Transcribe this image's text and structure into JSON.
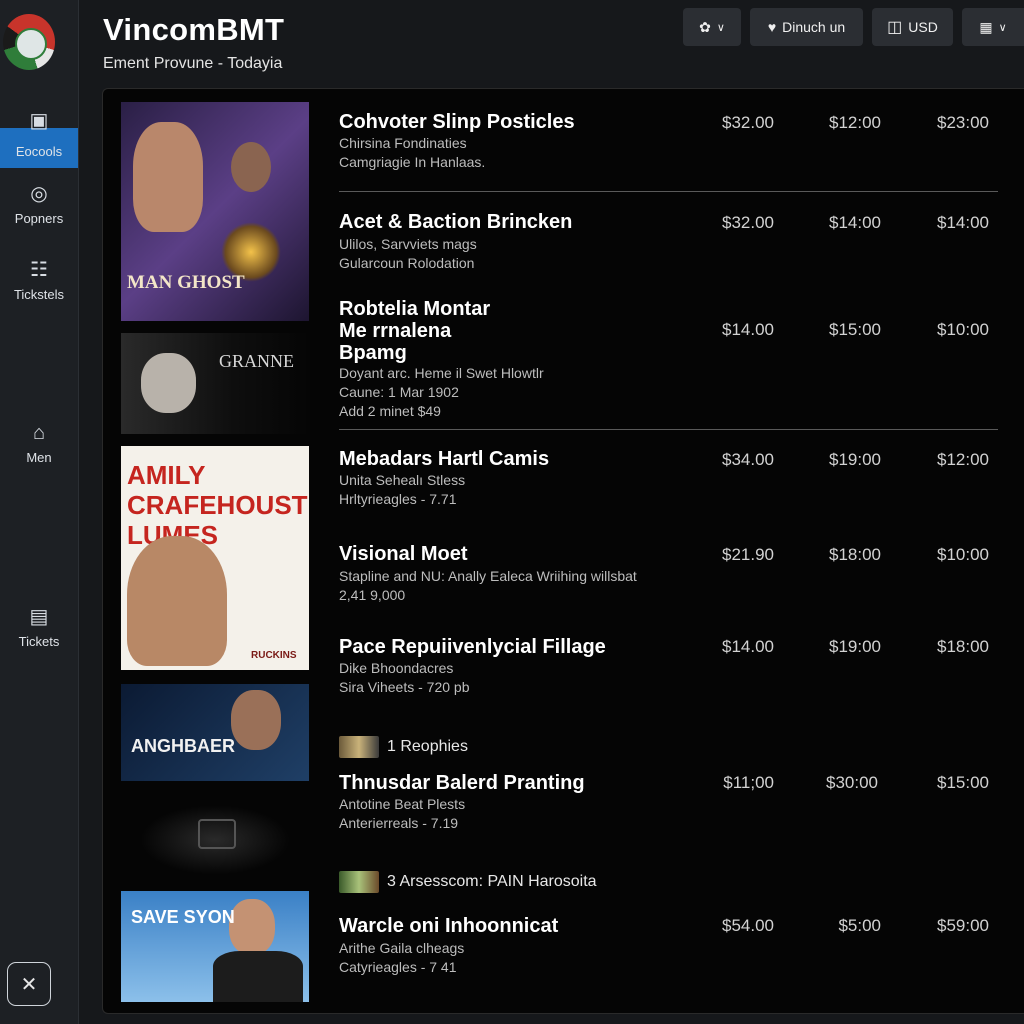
{
  "app": {
    "title": "VincomBMT",
    "subtitle": "Ement Provune - Todayia"
  },
  "header": {
    "user_label": "Dinuch un",
    "currency_label": "USD"
  },
  "sidebar": {
    "items": [
      {
        "label": "Eocools",
        "icon": "laptop-icon"
      },
      {
        "label": "Popners",
        "icon": "user-circle-icon"
      },
      {
        "label": "Tickstels",
        "icon": "barcode-icon"
      },
      {
        "label": "Men",
        "icon": "home-icon"
      },
      {
        "label": "Tickets",
        "icon": "ticket-icon"
      }
    ],
    "active_index": 0
  },
  "posters": [
    {
      "text": "MAN GHOST",
      "colors": [
        "#3a2a5c",
        "#6b4a8f"
      ]
    },
    {
      "text": "GRANNE",
      "colors": [
        "#101010",
        "#3b3b3b"
      ]
    },
    {
      "text": "AMILY CRAFEHOUST LUMES",
      "colors": [
        "#f2efe6",
        "#ffffff"
      ],
      "sub": "RUCKINS"
    },
    {
      "text": "ANGHBAER",
      "colors": [
        "#0d1f3a",
        "#24466e"
      ]
    },
    {
      "text": "SAVE SYON",
      "colors": [
        "#3d82c6",
        "#8ec1ea"
      ]
    }
  ],
  "listings": [
    {
      "title": "Cohvoter Slinp Posticles",
      "lines": "Chirsina Fondinaties\nCamgriagie In Hanlaas.",
      "prices": [
        "$32.00",
        "$12:00",
        "$23:00"
      ]
    },
    {
      "title": "Acet & Baction Brincken",
      "lines": "Ulilos, Sarvviets mags\nGularcoun Rolodation",
      "prices": [
        "$32.00",
        "$14:00",
        "$14:00"
      ]
    },
    {
      "title": "Robtelia Montar\nMe rrnalena\nBpamg",
      "lines": "Doyant arc. Heme il Swet Hlowtlr\nCaune: 1 Mar 1902\nAdd 2 minet $49",
      "prices": [
        "$14.00",
        "$15:00",
        "$10:00"
      ]
    },
    {
      "title": "Mebadars Hartl Camis",
      "lines": "Unita Sehealı Stless\nHrltyrieagles - 7.71",
      "prices": [
        "$34.00",
        "$19:00",
        "$12:00"
      ]
    },
    {
      "title": "Visional Moet",
      "lines": "Stapline and NU: Anally Ealeca Wriihing willsbat\n2,41 9,000",
      "prices": [
        "$21.90",
        "$18:00",
        "$10:00"
      ]
    },
    {
      "title": "Pace Repuiivenlycial Fillage",
      "lines": "Dike Bhoondacres\nSira Viheets - 720 pb",
      "prices": [
        "$14.00",
        "$19:00",
        "$18:00"
      ]
    },
    {
      "title": "Thnusdar Balerd Pranting",
      "lines": "Antotine Beat Plests\nAnterierreals - 7.19",
      "prices": [
        "$11;00",
        "$30:00",
        "$15:00"
      ]
    },
    {
      "title": "Warcle oni Inhoonnicat",
      "lines": "Arithe Gaila clheags\nCatyrieagles - 7 41",
      "prices": [
        "$54.00",
        "$5:00",
        "$59:00"
      ]
    }
  ],
  "extras": [
    {
      "label": "1 Reophies"
    },
    {
      "label": "3 Arsesscom: PAIN Harosoita"
    }
  ]
}
